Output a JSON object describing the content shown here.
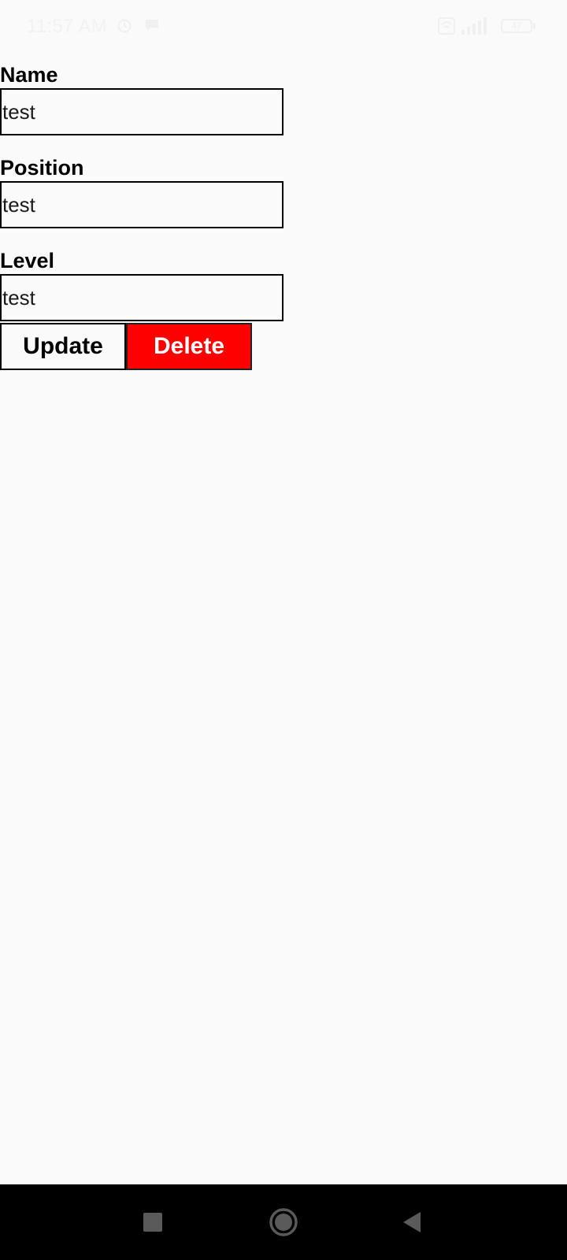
{
  "status_bar": {
    "time": "11:57 AM",
    "battery_level": "47",
    "icons": [
      "alarm-icon",
      "chat-bubble-icon",
      "wifi-box-icon",
      "signal-icon",
      "battery-icon"
    ]
  },
  "form": {
    "name": {
      "label": "Name",
      "value": "test"
    },
    "position": {
      "label": "Position",
      "value": "test"
    },
    "level": {
      "label": "Level",
      "value": "test"
    }
  },
  "actions": {
    "update_label": "Update",
    "delete_label": "Delete"
  },
  "colors": {
    "background": "#fafafa",
    "delete_button": "#ff0000",
    "nav_bar": "#000000"
  },
  "nav_bar": {
    "icons": [
      "recents-square-icon",
      "home-circle-icon",
      "back-triangle-icon"
    ]
  }
}
